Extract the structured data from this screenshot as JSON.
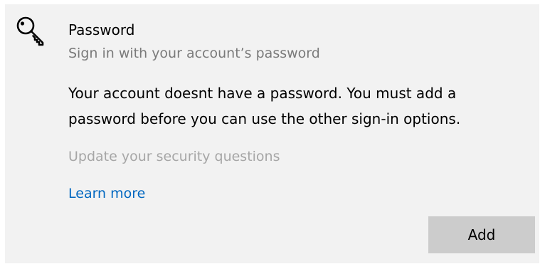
{
  "password_section": {
    "icon": "key-icon",
    "title": "Password",
    "subtitle": "Sign in with your account’s password",
    "message": "Your account doesnt have a password. You must add a password before you can use the other sign-in options.",
    "security_questions_link": "Update your security questions",
    "learn_more_link": "Learn more",
    "add_button_label": "Add"
  },
  "colors": {
    "panel_background": "#f2f2f2",
    "subtitle_text": "#7a7a7a",
    "disabled_link": "#a6a6a6",
    "link_accent": "#0067c0",
    "button_background": "#cccccc"
  }
}
